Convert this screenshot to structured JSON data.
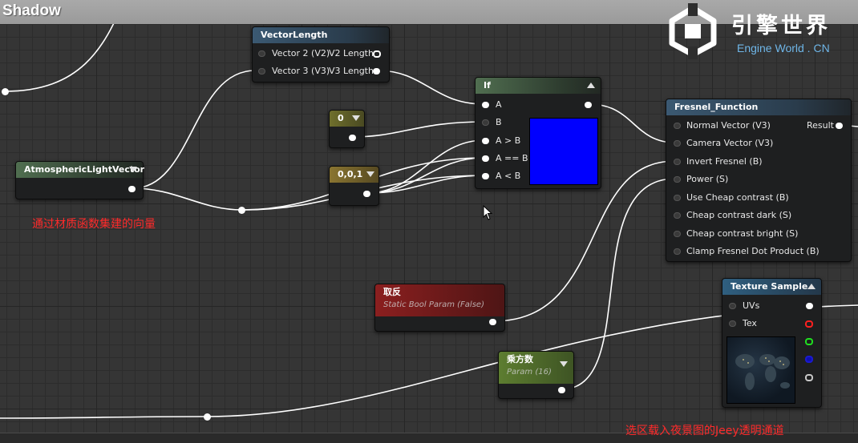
{
  "graph": {
    "title": "Shadow"
  },
  "logo": {
    "title": "引擎世界",
    "subtitle": "Engine World . CN"
  },
  "nodes": {
    "vector_length": {
      "title": "VectorLength",
      "inputs": [
        "Vector 2 (V2)",
        "Vector 3 (V3)"
      ],
      "outputs": [
        "V2 Length",
        "V3 Length"
      ]
    },
    "if": {
      "title": "If",
      "inputs": [
        "A",
        "B",
        "A > B",
        "A == B",
        "A < B"
      ]
    },
    "const_zero": {
      "title": "0"
    },
    "const_vec": {
      "title": "0,0,1"
    },
    "atmospheric": {
      "title": "AtmosphericLightVector"
    },
    "fresnel": {
      "title": "Fresnel_Function",
      "inputs": [
        "Normal Vector (V3)",
        "Camera Vector (V3)",
        "Invert Fresnel (B)",
        "Power (S)",
        "Use Cheap contrast (B)",
        "Cheap contrast dark (S)",
        "Cheap contrast bright (S)",
        "Clamp Fresnel Dot Product (B)"
      ],
      "output": "Result"
    },
    "invert_param": {
      "title": "取反",
      "subtitle": "Static Bool Param (False)"
    },
    "power_param": {
      "title": "乘方数",
      "subtitle": "Param (16)"
    },
    "texture_sample": {
      "title": "Texture Sample",
      "inputs": [
        "UVs",
        "Tex"
      ]
    }
  },
  "notes": {
    "vector_note": "通过材质函数集建的向量",
    "texture_note": "选区载入夜景图的Jeey透明通道"
  },
  "colors": {
    "if_preview": "#0000ff",
    "note_text": "#ff2a2a"
  }
}
